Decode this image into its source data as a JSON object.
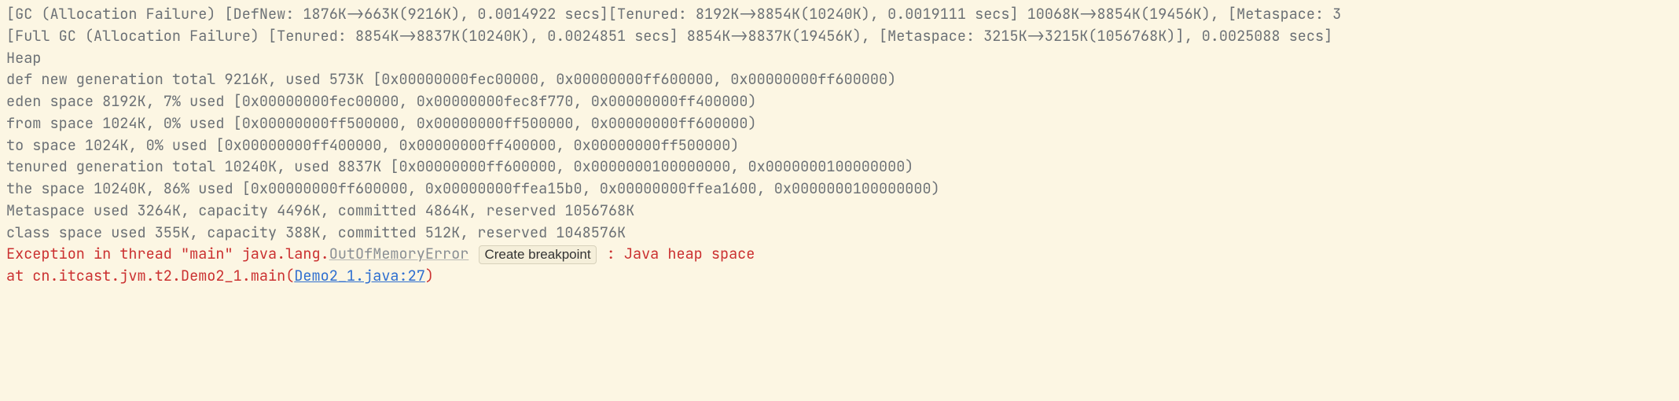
{
  "log": {
    "l1": "[GC (Allocation Failure) [DefNew: 1876K->663K(9216K), 0.0014922 secs][Tenured: 8192K->8854K(10240K), 0.0019111 secs] 10068K->8854K(19456K), [Metaspace: 3",
    "l2": "[Full GC (Allocation Failure) [Tenured: 8854K->8837K(10240K), 0.0024851 secs] 8854K->8837K(19456K), [Metaspace: 3215K->3215K(1056768K)], 0.0025088 secs]",
    "l3": "Heap",
    "l4": " def new generation   total 9216K, used 573K [0x00000000fec00000, 0x00000000ff600000, 0x00000000ff600000)",
    "l5": "  eden space 8192K,   7% used [0x00000000fec00000, 0x00000000fec8f770, 0x00000000ff400000)",
    "l6": "  from space 1024K,   0% used [0x00000000ff500000, 0x00000000ff500000, 0x00000000ff600000)",
    "l7": "  to   space 1024K,   0% used [0x00000000ff400000, 0x00000000ff400000, 0x00000000ff500000)",
    "l8": " tenured generation   total 10240K, used 8837K [0x00000000ff600000, 0x0000000100000000, 0x0000000100000000)",
    "l9": "   the space 10240K,  86% used [0x00000000ff600000, 0x00000000ffea15b0, 0x00000000ffea1600, 0x0000000100000000)",
    "l10": " Metaspace       used 3264K, capacity 4496K, committed 4864K, reserved 1056768K",
    "l11": "  class space    used 355K, capacity 388K, committed 512K, reserved 1048576K"
  },
  "exception": {
    "prefix": "Exception in thread \"main\" ",
    "class_pkg": "java.lang.",
    "class_name": "OutOfMemoryError",
    "breakpoint_label": "Create breakpoint",
    "suffix": " : Java heap space",
    "at_prefix": "\tat cn.itcast.jvm.t2.Demo2_1.main(",
    "source_link": "Demo2_1.java:27",
    "at_suffix": ")"
  }
}
